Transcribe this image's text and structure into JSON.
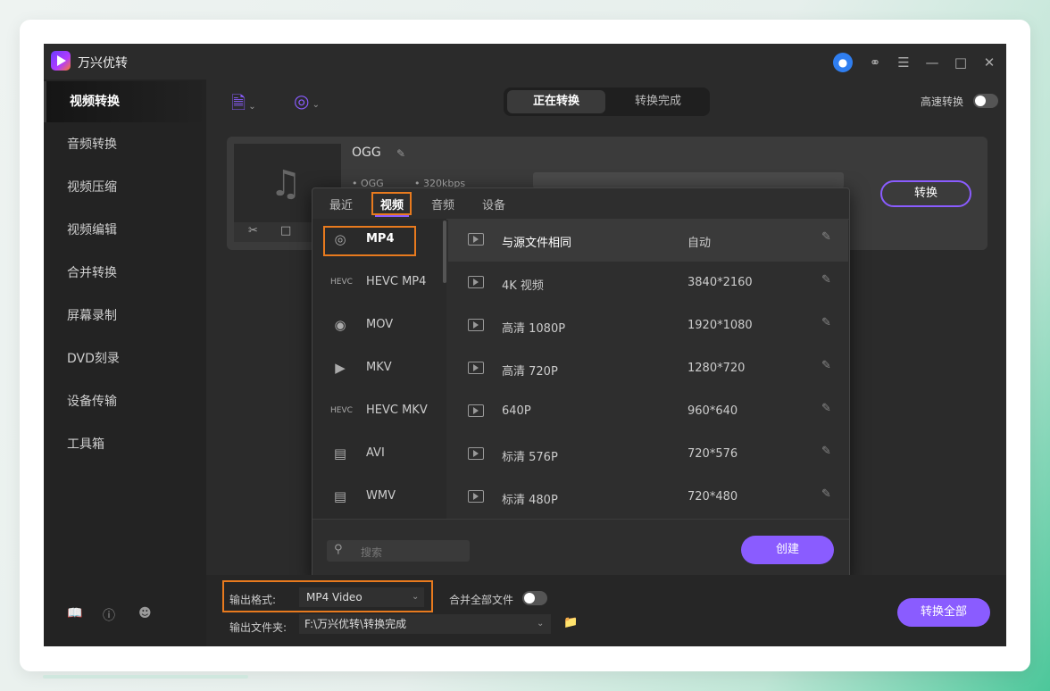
{
  "app": {
    "title": "万兴优转"
  },
  "sidebar": {
    "items": [
      {
        "label": "视频转换",
        "active": true
      },
      {
        "label": "音频转换"
      },
      {
        "label": "视频压缩"
      },
      {
        "label": "视频编辑"
      },
      {
        "label": "合并转换"
      },
      {
        "label": "屏幕录制"
      },
      {
        "label": "DVD刻录"
      },
      {
        "label": "设备传输"
      },
      {
        "label": "工具箱"
      }
    ],
    "bottom_icons": [
      "book-icon",
      "help-icon",
      "user-icon"
    ]
  },
  "header": {
    "tabs": [
      {
        "label": "正在转换",
        "active": true
      },
      {
        "label": "转换完成"
      }
    ],
    "fast_convert_label": "高速转换"
  },
  "file": {
    "name": "OGG",
    "format": "OGG",
    "bitrate": "320kbps",
    "convert_label": "转换"
  },
  "popup": {
    "tabs": [
      {
        "label": "最近"
      },
      {
        "label": "视频",
        "active": true
      },
      {
        "label": "音频"
      },
      {
        "label": "设备"
      }
    ],
    "formats": [
      {
        "label": "MP4",
        "icon": "mp4-icon",
        "selected": true
      },
      {
        "label": "HEVC MP4",
        "icon": "hevc-icon"
      },
      {
        "label": "MOV",
        "icon": "mov-icon"
      },
      {
        "label": "MKV",
        "icon": "mkv-icon"
      },
      {
        "label": "HEVC MKV",
        "icon": "hevc-icon"
      },
      {
        "label": "AVI",
        "icon": "avi-icon"
      },
      {
        "label": "WMV",
        "icon": "wmv-icon"
      }
    ],
    "resolutions": [
      {
        "name": "与源文件相同",
        "size": "自动",
        "selected": true
      },
      {
        "name": "4K 视频",
        "size": "3840*2160"
      },
      {
        "name": "高清 1080P",
        "size": "1920*1080"
      },
      {
        "name": "高清 720P",
        "size": "1280*720"
      },
      {
        "name": "640P",
        "size": "960*640"
      },
      {
        "name": "标清 576P",
        "size": "720*576"
      },
      {
        "name": "标清 480P",
        "size": "720*480"
      }
    ],
    "search_placeholder": "搜索",
    "create_label": "创建"
  },
  "bottom": {
    "output_format_label": "输出格式:",
    "output_format_value": "MP4 Video",
    "merge_label": "合并全部文件",
    "output_folder_label": "输出文件夹:",
    "output_folder_value": "F:\\万兴优转\\转换完成",
    "convert_all_label": "转换全部"
  },
  "colors": {
    "accent": "#8a5cff",
    "highlight": "#e87a1e",
    "avatar": "#2f7ef0"
  }
}
